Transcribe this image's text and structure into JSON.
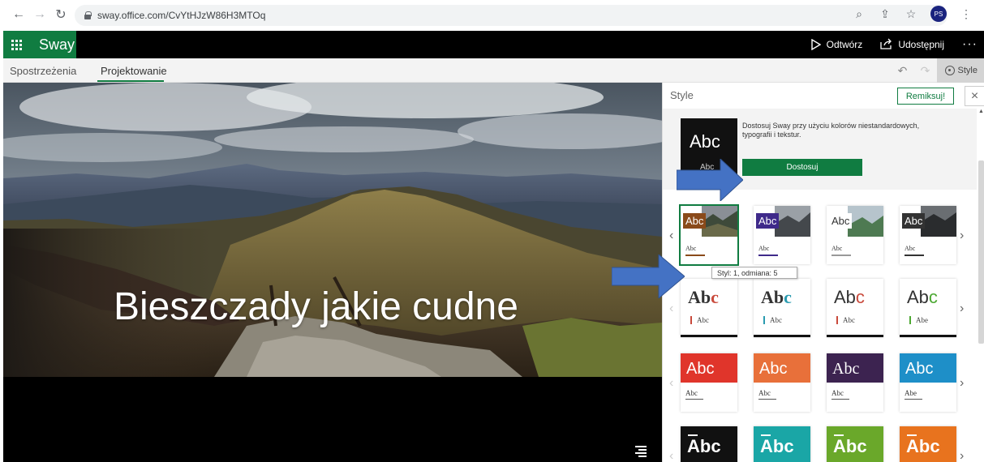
{
  "browser": {
    "url": "sway.office.com/CvYtHJzW86H3MTOq",
    "profile_initials": "PS"
  },
  "app": {
    "name": "Sway",
    "actions": {
      "play_label": "Odtwórz",
      "share_label": "Udostępnij",
      "more_label": "···"
    }
  },
  "tabs": [
    {
      "label": "Spostrzeżenia",
      "active": false
    },
    {
      "label": "Projektowanie",
      "active": true
    }
  ],
  "toolbar": {
    "style_label": "Style"
  },
  "canvas": {
    "title": "Bieszczady jakie cudne"
  },
  "style_panel": {
    "title": "Style",
    "remix_label": "Remiksuj!",
    "close_label": "×",
    "customize": {
      "thumb_big": "Abc",
      "thumb_small": "Abc",
      "description": "Dostosuj Sway przy użyciu kolorów niestandardowych, typografii i tekstur.",
      "button_label": "Dostosuj"
    },
    "tooltip": "Styl: 1, odmiana: 5",
    "rows": [
      {
        "kind": "photo",
        "cards": [
          {
            "label": "Abc",
            "sub": "Abc",
            "color": "#8a4a1a"
          },
          {
            "label": "Abc",
            "sub": "Abc",
            "color": "#3f2a8a"
          },
          {
            "label": "Abc",
            "sub": "Abc",
            "color": "#ffffff"
          },
          {
            "label": "Abc",
            "sub": "Abc",
            "color": "#333333"
          }
        ]
      },
      {
        "kind": "serif",
        "cards": [
          {
            "label_main": "Ab",
            "label_accent": "c",
            "sub": "Abc",
            "accent": "#c94a3c"
          },
          {
            "label_main": "Ab",
            "label_accent": "c",
            "sub": "Abc",
            "accent": "#2a9bb0"
          },
          {
            "label_main": "Ab",
            "label_accent": "c",
            "sub": "Abc",
            "accent": "#c94a3c"
          },
          {
            "label_main": "Ab",
            "label_accent": "c",
            "sub": "Abe",
            "accent": "#4ca832"
          }
        ]
      },
      {
        "kind": "color",
        "cards": [
          {
            "label": "Abc",
            "sub": "Abc",
            "color": "#e0352b"
          },
          {
            "label": "Abc",
            "sub": "Abc",
            "color": "#e8703a"
          },
          {
            "label": "Abc",
            "sub": "Abc",
            "color": "#3c2350"
          },
          {
            "label": "Abc",
            "sub": "Abe",
            "color": "#1e8fc8"
          }
        ]
      },
      {
        "kind": "dark",
        "cards": [
          {
            "label": "Abc",
            "color": "#111111"
          },
          {
            "label": "Abc",
            "color": "#1aa6a6"
          },
          {
            "label": "Abc",
            "color": "#6aa82a"
          },
          {
            "label": "Abc",
            "color": "#e8731e"
          }
        ]
      }
    ]
  },
  "colors": {
    "brand_green": "#107c41",
    "arrow_blue": "#4472c4"
  }
}
